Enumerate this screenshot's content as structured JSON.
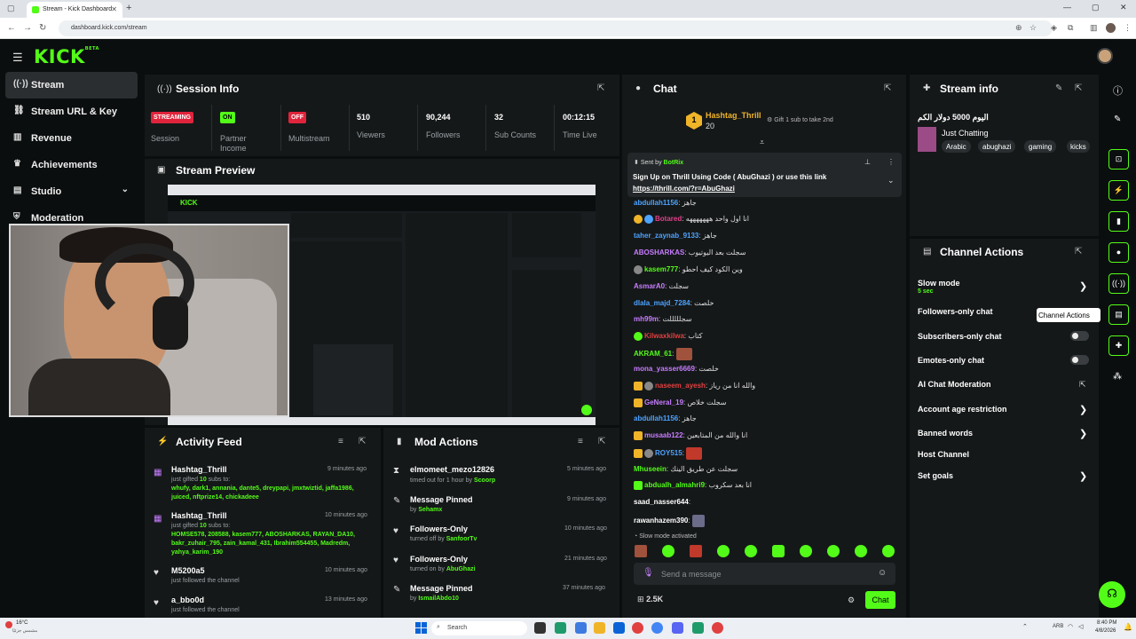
{
  "browser": {
    "tab_title": "Stream - Kick Dashboard",
    "url": "dashboard.kick.com/stream"
  },
  "app": {
    "logo": "KICK",
    "logo_sup": "BETA"
  },
  "sidebar": {
    "items": [
      {
        "label": "Stream",
        "icon": "signal-icon",
        "glyph": "((·))"
      },
      {
        "label": "Stream URL & Key",
        "icon": "link-icon",
        "glyph": "⛓"
      },
      {
        "label": "Revenue",
        "icon": "chart-icon",
        "glyph": "▥"
      },
      {
        "label": "Achievements",
        "icon": "trophy-icon",
        "glyph": "♛"
      },
      {
        "label": "Studio",
        "icon": "studio-icon",
        "glyph": "▤"
      },
      {
        "label": "Moderation",
        "icon": "shield-icon",
        "glyph": "⛨"
      }
    ]
  },
  "session": {
    "title": "Session Info",
    "streaming_badge": "STREAMING",
    "streaming_label": "Session",
    "partner_badge": "ON",
    "partner_label": "Partner Income",
    "multi_badge": "OFF",
    "multi_label": "Multistream",
    "viewers": "510",
    "viewers_label": "Viewers",
    "followers": "90,244",
    "followers_label": "Followers",
    "subs": "32",
    "subs_label": "Sub Counts",
    "time": "00:12:15",
    "time_label": "Time Live"
  },
  "preview": {
    "title": "Stream Preview"
  },
  "activity": {
    "title": "Activity Feed",
    "items": [
      {
        "user": "Hashtag_Thrill",
        "time": "9 minutes ago",
        "sub": "just gifted",
        "count": "10",
        "sub2": "subs to:",
        "names": "whufy, dark1, annania, dante5, dreypapi, jmxtwiztid, jaffa1986, juiced, nftprize14, chickadeee"
      },
      {
        "user": "Hashtag_Thrill",
        "time": "10 minutes ago",
        "sub": "just gifted",
        "count": "10",
        "sub2": "subs to:",
        "names": "HOMSE578, 208588, kasem777, ABOSHARKAS, RAYAN_DA10, bakr_zuhair_795, zain_kamal_431, Ibrahim554455, Madredm, yahya_karim_190"
      },
      {
        "user": "M5200a5",
        "time": "10 minutes ago",
        "sub": "just followed the channel"
      },
      {
        "user": "a_bbo0d",
        "time": "13 minutes ago",
        "sub": "just followed the channel"
      }
    ]
  },
  "mod": {
    "title": "Mod Actions",
    "items": [
      {
        "title": "elmomeet_mezo12826",
        "time": "5 minutes ago",
        "sub": "timed out for 1 hour by",
        "by": "Scoorp",
        "icon": "hourglass-icon",
        "glyph": "⧗"
      },
      {
        "title": "Message Pinned",
        "time": "9 minutes ago",
        "sub": "by",
        "by": "Sehamx",
        "icon": "pin-icon",
        "glyph": "📌"
      },
      {
        "title": "Followers-Only",
        "time": "10 minutes ago",
        "sub": "turned off by",
        "by": "SanfoorTv",
        "icon": "heart-icon",
        "glyph": "♥"
      },
      {
        "title": "Followers-Only",
        "time": "21 minutes ago",
        "sub": "turned on by",
        "by": "AbuGhazi",
        "icon": "heart-icon",
        "glyph": "♥"
      },
      {
        "title": "Message Pinned",
        "time": "37 minutes ago",
        "sub": "by",
        "by": "IsmailAbdo10",
        "icon": "pin-icon",
        "glyph": "📌"
      }
    ]
  },
  "chat": {
    "title": "Chat",
    "top_gifter": "Hashtag_Thrill",
    "top_gifter_count": "20",
    "gift_prompt": "Gift 1 sub to take 2nd",
    "pinned_sent_by": "Sent by",
    "pinned_bot": "BotRix",
    "pinned_text": "Sign Up on Thrill Using Code ( AbuGhazi ) or use this link",
    "pinned_link": "https://thrill.com/?r=AbuGhazi",
    "messages": [
      {
        "user": "abdullah1156",
        "text": "جاهز",
        "color": "#4da3ff"
      },
      {
        "user": "Botared",
        "text": "انا اول واحد هههههههه",
        "color": "#e0408a"
      },
      {
        "user": "taher_zaynab_9133",
        "text": "جاهز",
        "color": "#4da3ff"
      },
      {
        "user": "ABOSHARKAS",
        "text": "سجلت بعد اليوتيوب",
        "color": "#c77dff"
      },
      {
        "user": "kasem777",
        "text": "وين الكود كيف احطو",
        "color": "#53fc18"
      },
      {
        "user": "AsmarA0",
        "text": "سجلت",
        "color": "#c77dff"
      },
      {
        "user": "dlala_majd_7284",
        "text": "خلصت",
        "color": "#4da3ff"
      },
      {
        "user": "mh99m",
        "text": "سجلللللت",
        "color": "#c77dff"
      },
      {
        "user": "Kilwaxkilwa",
        "text": "كتاب",
        "color": "#e04040"
      },
      {
        "user": "AKRAM_61",
        "text": "",
        "color": "#53fc18"
      },
      {
        "user": "mona_yasser6669",
        "text": "خلصت",
        "color": "#c77dff"
      },
      {
        "user": "naseem_ayesh",
        "text": "والله انا من رياز",
        "color": "#e04040"
      },
      {
        "user": "GeNeral_19",
        "text": "سجلت خلاص",
        "color": "#c77dff"
      },
      {
        "user": "abdullah1156",
        "text": "جاهز",
        "color": "#4da3ff"
      },
      {
        "user": "musaab122",
        "text": "انا والله من المتابعين",
        "color": "#c77dff"
      },
      {
        "user": "ROY515",
        "text": "",
        "color": "#4da3ff"
      },
      {
        "user": "Mhuseein",
        "text": "سجلت عن طريق الينك",
        "color": "#53fc18"
      },
      {
        "user": "abdualh_almahri9",
        "text": "انا بعد سكروب",
        "color": "#53fc18"
      },
      {
        "user": "saad_nasser644",
        "text": "",
        "color": "#fff"
      },
      {
        "user": "rawanhazem390",
        "text": "",
        "color": "#fff"
      }
    ],
    "slow_mode_notice": "Slow mode activated",
    "input_placeholder": "Send a message",
    "viewer_count": "2.5K",
    "send_label": "Chat"
  },
  "stream_info": {
    "title": "Stream info",
    "stream_title": "اليوم 5000 دولار الكم",
    "category": "Just Chatting",
    "tags": [
      "Arabic",
      "abughazi",
      "gaming",
      "kicks"
    ]
  },
  "channel_actions": {
    "title": "Channel Actions",
    "tooltip": "Channel Actions",
    "slow_mode": "Slow mode",
    "slow_mode_value": "5 sec",
    "followers_only": "Followers-only chat",
    "subscribers_only": "Subscribers-only chat",
    "emotes_only": "Emotes-only chat",
    "ai_moderation": "AI Chat Moderation",
    "account_age": "Account age restriction",
    "banned_words": "Banned words",
    "host_channel": "Host Channel",
    "set_goals": "Set goals"
  },
  "taskbar": {
    "weather": "16°C",
    "weather_sub": "مشمس جزئيًا",
    "search": "Search",
    "time": "8:40 PM",
    "date": "4/8/2026",
    "lang": "ARB"
  },
  "colors": {
    "accent": "#53fc18",
    "panel": "#151819",
    "bg": "#0b0e0f",
    "streaming": "#e0243c"
  }
}
